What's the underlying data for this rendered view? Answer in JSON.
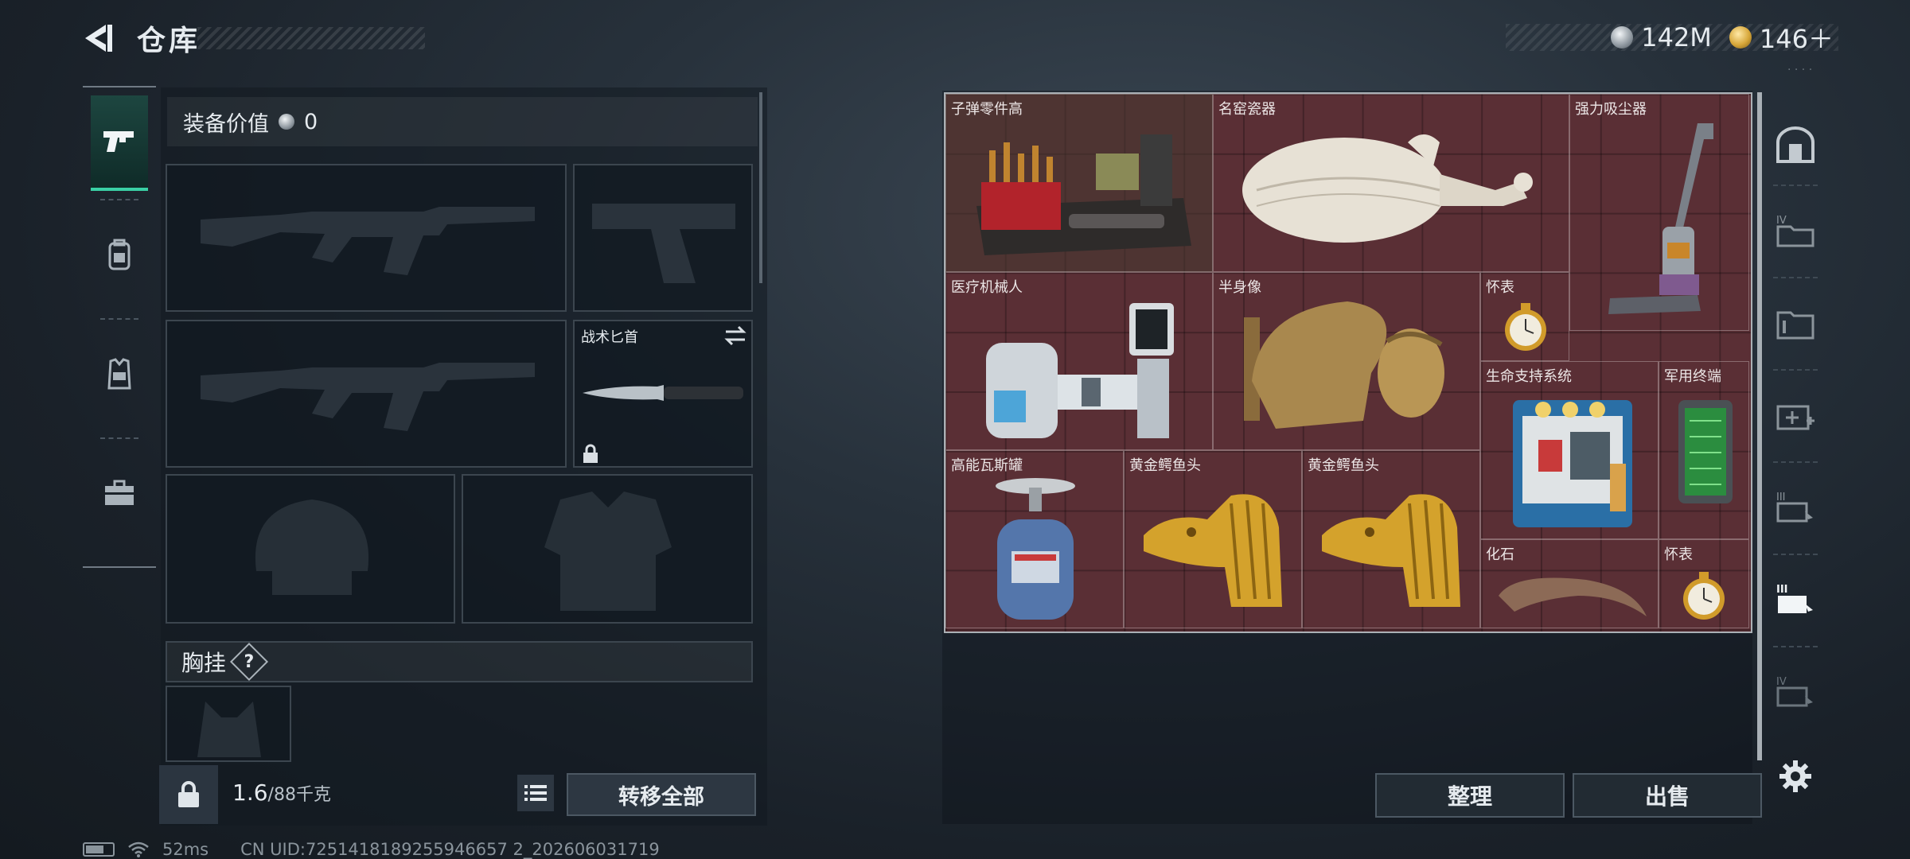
{
  "header": {
    "title": "仓库",
    "currencies": [
      {
        "icon": "silver-coin-icon",
        "value": "142M"
      },
      {
        "icon": "gold-coin-icon",
        "value": "146＋"
      }
    ]
  },
  "left_tabs": [
    {
      "name": "weapons",
      "icon": "pistol-icon",
      "active": true
    },
    {
      "name": "backpack",
      "icon": "backpack-icon",
      "active": false
    },
    {
      "name": "vest",
      "icon": "vest-icon",
      "active": false
    },
    {
      "name": "case",
      "icon": "briefcase-icon",
      "active": false
    }
  ],
  "loadout": {
    "equip_value_label": "装备价值",
    "equip_value": "0",
    "knife_label": "战术匕首",
    "chest_rig_label": "胸挂",
    "help_glyph": "?",
    "weight_current": "1.6",
    "weight_max": "/88千克",
    "transfer_all_label": "转移全部"
  },
  "container": {
    "items": [
      {
        "label": "子弹零件高"
      },
      {
        "label": "名窑瓷器"
      },
      {
        "label": "强力吸尘器"
      },
      {
        "label": "医疗机械人"
      },
      {
        "label": "半身像"
      },
      {
        "label": "怀表"
      },
      {
        "label": "生命支持系统"
      },
      {
        "label": "军用终端"
      },
      {
        "label": "高能瓦斯罐"
      },
      {
        "label": "黄金鳄鱼头"
      },
      {
        "label": "黄金鳄鱼头"
      },
      {
        "label": "化石"
      },
      {
        "label": "怀表"
      }
    ],
    "sort_label": "整理",
    "sell_label": "出售"
  },
  "status_bar": {
    "ping": "52ms",
    "uid": "CN UID:7251418189255946657 2_202606031719"
  },
  "colors": {
    "accent": "#3ad0a5",
    "grid_bg": "#5a2f35",
    "gold": "#d4a22c"
  }
}
